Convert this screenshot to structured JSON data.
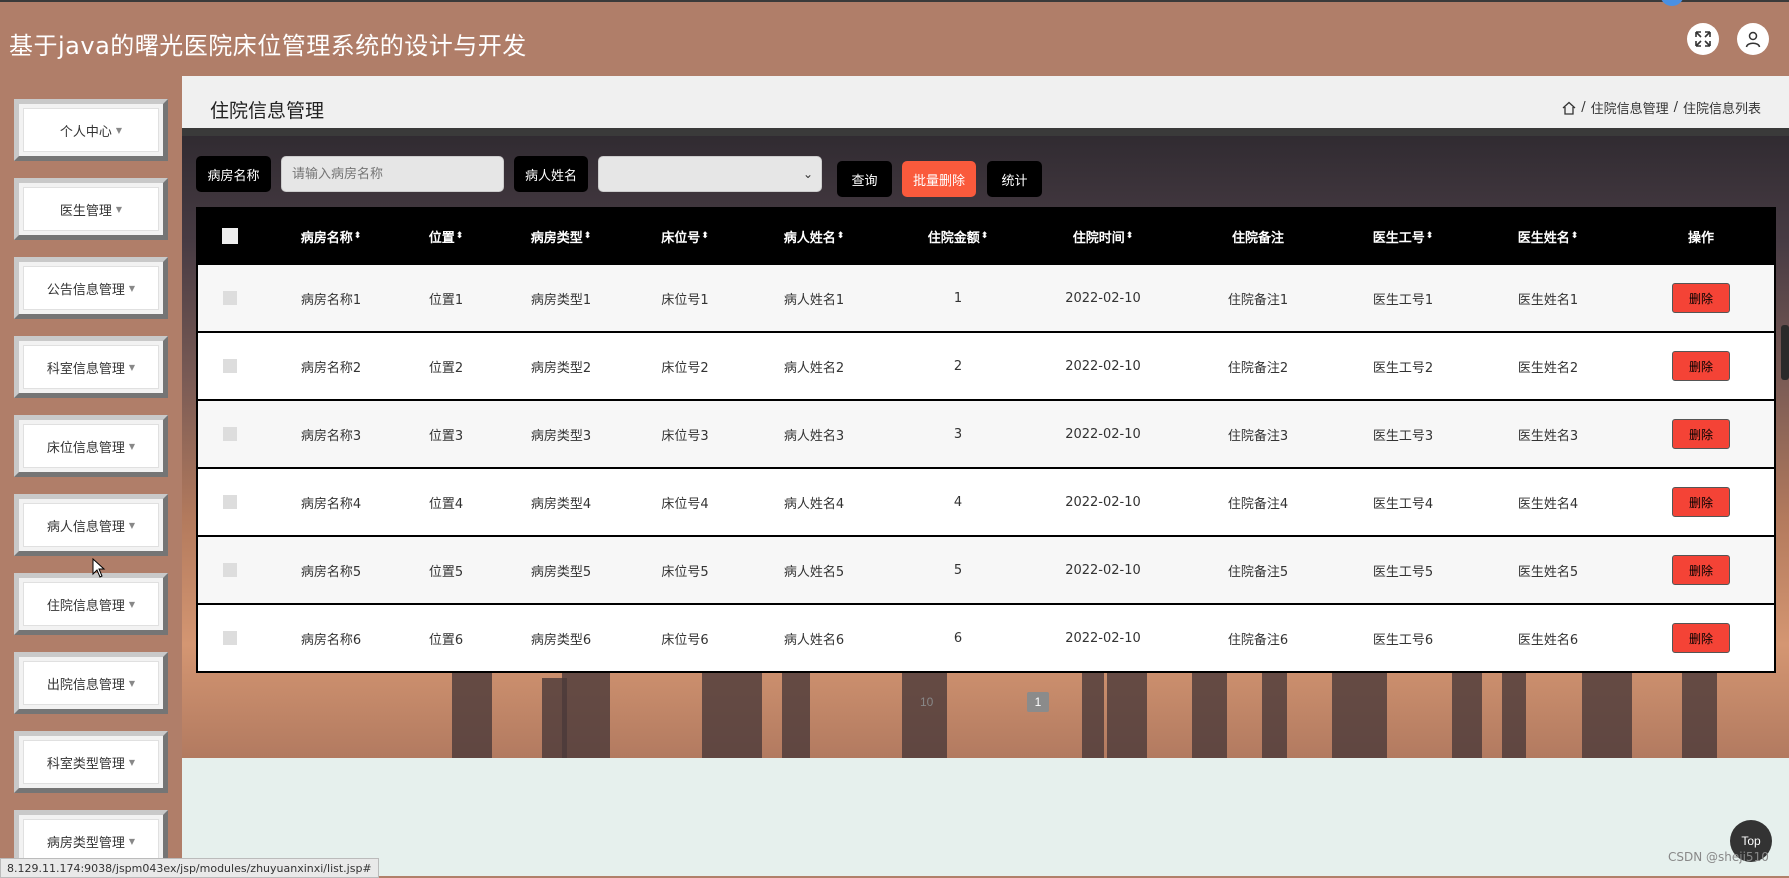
{
  "app": {
    "title": "基于java的曙光医院床位管理系统的设计与开发"
  },
  "header": {
    "fullscreen_icon": "fullscreen-icon",
    "user_icon": "user-icon"
  },
  "sidebar": {
    "items": [
      {
        "label": "个人中心"
      },
      {
        "label": "医生管理"
      },
      {
        "label": "公告信息管理"
      },
      {
        "label": "科室信息管理"
      },
      {
        "label": "床位信息管理"
      },
      {
        "label": "病人信息管理"
      },
      {
        "label": "住院信息管理"
      },
      {
        "label": "出院信息管理"
      },
      {
        "label": "科室类型管理"
      },
      {
        "label": "病房类型管理"
      }
    ]
  },
  "page": {
    "title": "住院信息管理",
    "breadcrumb": [
      "住院信息管理",
      "住院信息列表"
    ]
  },
  "search": {
    "room_label": "病房名称",
    "room_placeholder": "请输入病房名称",
    "patient_label": "病人姓名",
    "query_button": "查询",
    "batch_delete_button": "批量删除",
    "stats_button": "统计"
  },
  "table": {
    "headers": [
      "病房名称",
      "位置",
      "病房类型",
      "床位号",
      "病人姓名",
      "住院金额",
      "住院时间",
      "住院备注",
      "医生工号",
      "医生姓名",
      "操作"
    ],
    "rows": [
      [
        "病房名称1",
        "位置1",
        "病房类型1",
        "床位号1",
        "病人姓名1",
        "1",
        "2022-02-10",
        "住院备注1",
        "医生工号1",
        "医生姓名1",
        "删除"
      ],
      [
        "病房名称2",
        "位置2",
        "病房类型2",
        "床位号2",
        "病人姓名2",
        "2",
        "2022-02-10",
        "住院备注2",
        "医生工号2",
        "医生姓名2",
        "删除"
      ],
      [
        "病房名称3",
        "位置3",
        "病房类型3",
        "床位号3",
        "病人姓名3",
        "3",
        "2022-02-10",
        "住院备注3",
        "医生工号3",
        "医生姓名3",
        "删除"
      ],
      [
        "病房名称4",
        "位置4",
        "病房类型4",
        "床位号4",
        "病人姓名4",
        "4",
        "2022-02-10",
        "住院备注4",
        "医生工号4",
        "医生姓名4",
        "删除"
      ],
      [
        "病房名称5",
        "位置5",
        "病房类型5",
        "床位号5",
        "病人姓名5",
        "5",
        "2022-02-10",
        "住院备注5",
        "医生工号5",
        "医生姓名5",
        "删除"
      ],
      [
        "病房名称6",
        "位置6",
        "病房类型6",
        "床位号6",
        "病人姓名6",
        "6",
        "2022-02-10",
        "住院备注6",
        "医生工号6",
        "医生姓名6",
        "删除"
      ]
    ]
  },
  "pagination": {
    "page_size": "10",
    "current": "1"
  },
  "status_url": "8.129.11.174:9038/jspm043ex/jsp/modules/zhuyuanxinxi/list.jsp#",
  "top_button": "Top",
  "watermark": "CSDN @sheji510"
}
